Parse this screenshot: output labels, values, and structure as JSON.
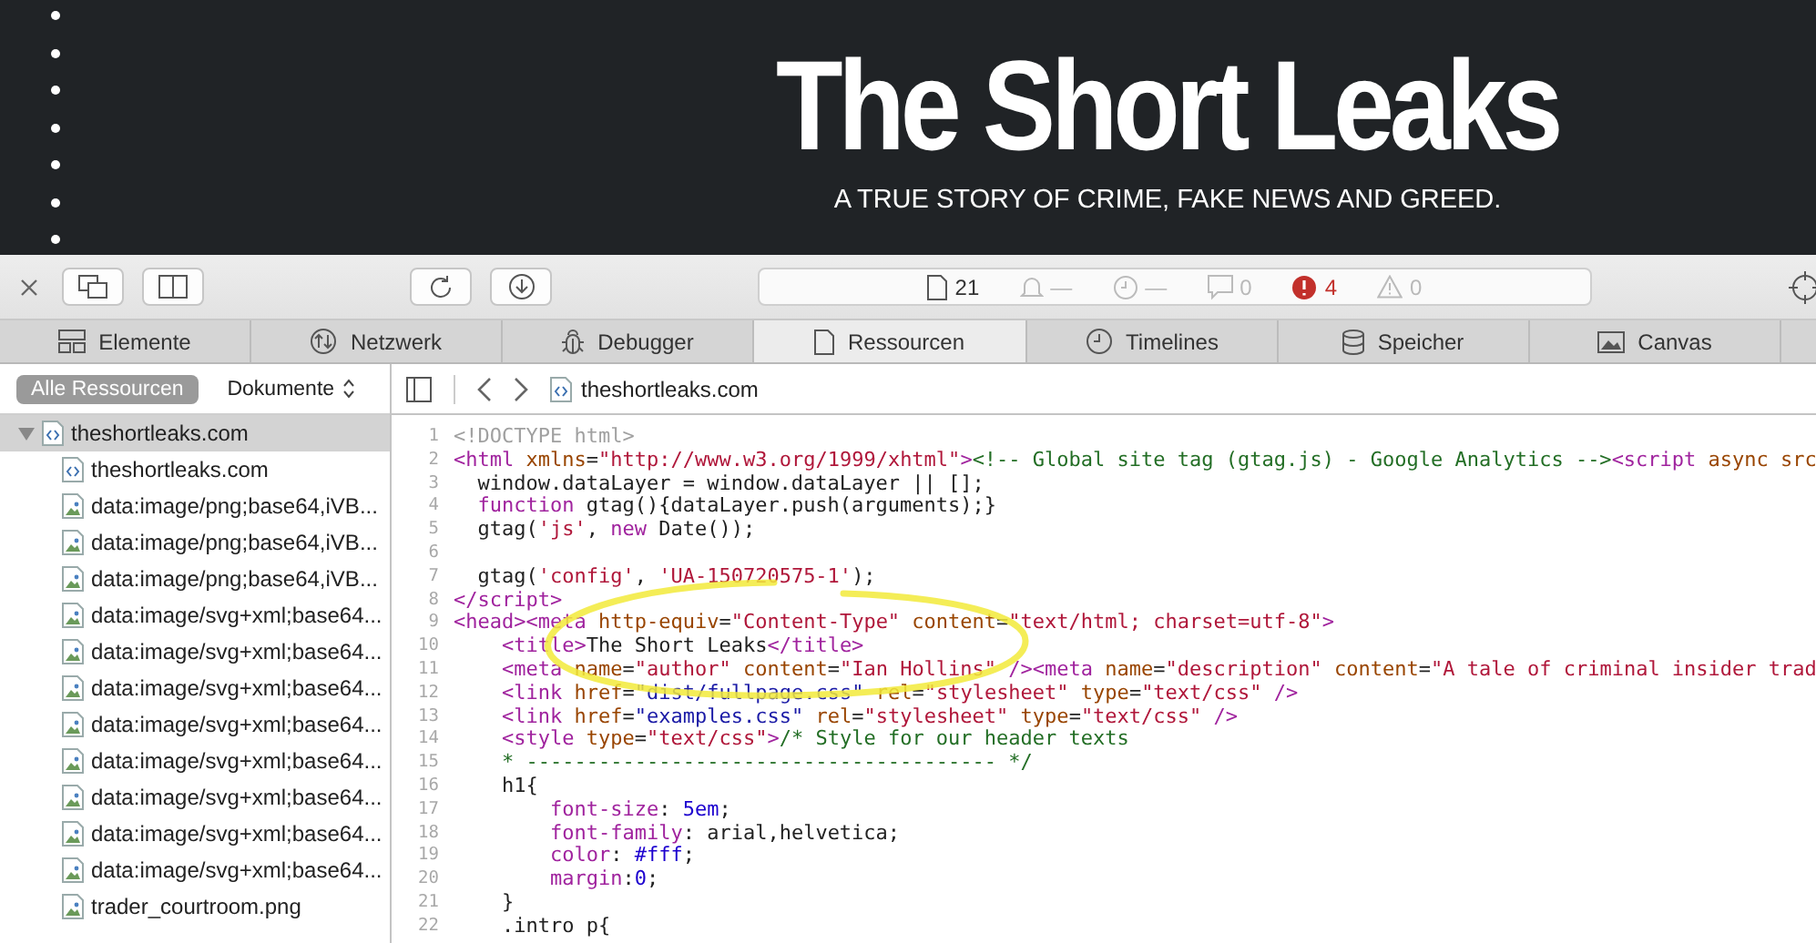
{
  "header": {
    "title": "The Short Leaks",
    "tagline": "A TRUE STORY OF CRIME, FAKE NEWS AND GREED."
  },
  "toolbar": {
    "status": [
      {
        "kind": "document",
        "text": "21"
      },
      {
        "kind": "bell",
        "text": "—"
      },
      {
        "kind": "clock",
        "text": "—"
      },
      {
        "kind": "log",
        "text": "0"
      },
      {
        "kind": "error",
        "text": "4"
      },
      {
        "kind": "warning",
        "text": "0"
      }
    ]
  },
  "tabs": [
    {
      "label": "Elemente",
      "kind": "elements",
      "selected": false
    },
    {
      "label": "Netzwerk",
      "kind": "network",
      "selected": false
    },
    {
      "label": "Debugger",
      "kind": "debugger",
      "selected": false
    },
    {
      "label": "Ressourcen",
      "kind": "resources",
      "selected": true
    },
    {
      "label": "Timelines",
      "kind": "timelines",
      "selected": false
    },
    {
      "label": "Speicher",
      "kind": "storage",
      "selected": false
    },
    {
      "label": "Canvas",
      "kind": "canvas",
      "selected": false
    }
  ],
  "sidebar": {
    "filters": [
      {
        "label": "Alle Ressourcen",
        "kind": "toggle",
        "selected": true
      },
      {
        "label": "Dokumente",
        "kind": "popup",
        "selected": false
      }
    ],
    "tree": [
      {
        "label": "theshortleaks.com",
        "kind": "html",
        "expanded": true,
        "selected": true,
        "children": [
          {
            "label": "theshortleaks.com",
            "kind": "html",
            "selected": false
          },
          {
            "label": "data:image/png;base64,iVB...",
            "kind": "image",
            "selected": false
          },
          {
            "label": "data:image/png;base64,iVB...",
            "kind": "image",
            "selected": false
          },
          {
            "label": "data:image/png;base64,iVB...",
            "kind": "image",
            "selected": false
          },
          {
            "label": "data:image/svg+xml;base64...",
            "kind": "image",
            "selected": false
          },
          {
            "label": "data:image/svg+xml;base64...",
            "kind": "image",
            "selected": false
          },
          {
            "label": "data:image/svg+xml;base64...",
            "kind": "image",
            "selected": false
          },
          {
            "label": "data:image/svg+xml;base64...",
            "kind": "image",
            "selected": false
          },
          {
            "label": "data:image/svg+xml;base64...",
            "kind": "image",
            "selected": false
          },
          {
            "label": "data:image/svg+xml;base64...",
            "kind": "image",
            "selected": false
          },
          {
            "label": "data:image/svg+xml;base64...",
            "kind": "image",
            "selected": false
          },
          {
            "label": "data:image/svg+xml;base64...",
            "kind": "image",
            "selected": false
          },
          {
            "label": "trader_courtroom.png",
            "kind": "image",
            "selected": false
          }
        ]
      }
    ]
  },
  "editor": {
    "file": "theshortleaks.com",
    "lines": [
      {
        "number": "1",
        "tokens": [
          {
            "kind": "doctype",
            "text": "<!DOCTYPE html>"
          }
        ]
      },
      {
        "number": "2",
        "tokens": [
          {
            "kind": "tag",
            "text": "<html "
          },
          {
            "kind": "attr",
            "text": "xmlns"
          },
          {
            "kind": "plain",
            "text": "="
          },
          {
            "kind": "string",
            "text": "\"http://www.w3.org/1999/xhtml\""
          },
          {
            "kind": "tag",
            "text": ">"
          },
          {
            "kind": "comment",
            "text": "<!-- Global site tag (gtag.js) - Google Analytics -->"
          },
          {
            "kind": "tag",
            "text": "<script "
          },
          {
            "kind": "attr",
            "text": "async src"
          }
        ]
      },
      {
        "number": "3",
        "tokens": [
          {
            "kind": "plain",
            "text": "  window.dataLayer = window.dataLayer || [];"
          }
        ]
      },
      {
        "number": "4",
        "tokens": [
          {
            "kind": "keyword",
            "text": "  function"
          },
          {
            "kind": "plain",
            "text": " gtag(){dataLayer.push(arguments);}"
          }
        ]
      },
      {
        "number": "5",
        "tokens": [
          {
            "kind": "plain",
            "text": "  gtag("
          },
          {
            "kind": "string",
            "text": "'js'"
          },
          {
            "kind": "plain",
            "text": ", "
          },
          {
            "kind": "keyword",
            "text": "new"
          },
          {
            "kind": "plain",
            "text": " Date());"
          }
        ]
      },
      {
        "number": "6"
      },
      {
        "number": "7",
        "tokens": [
          {
            "kind": "plain",
            "text": "  gtag("
          },
          {
            "kind": "string",
            "text": "'config'"
          },
          {
            "kind": "plain",
            "text": ", "
          },
          {
            "kind": "string",
            "text": "'UA-150720575-1'"
          },
          {
            "kind": "plain",
            "text": ");"
          }
        ]
      },
      {
        "number": "8",
        "tokens": [
          {
            "kind": "tag",
            "text": "</script>"
          }
        ]
      },
      {
        "number": "9",
        "tokens": [
          {
            "kind": "tag",
            "text": "<head><meta "
          },
          {
            "kind": "attr",
            "text": "http-equiv"
          },
          {
            "kind": "plain",
            "text": "="
          },
          {
            "kind": "string",
            "text": "\"Content-Type\""
          },
          {
            "kind": "attr",
            "text": " content"
          },
          {
            "kind": "plain",
            "text": "="
          },
          {
            "kind": "string",
            "text": "\"text/html; charset=utf-8\""
          },
          {
            "kind": "tag",
            "text": ">"
          }
        ]
      },
      {
        "number": "10",
        "tokens": [
          {
            "kind": "tag",
            "text": "    <title>"
          },
          {
            "kind": "plain",
            "text": "The Short Leaks"
          },
          {
            "kind": "tag",
            "text": "</title>"
          }
        ]
      },
      {
        "number": "11",
        "tokens": [
          {
            "kind": "tag",
            "text": "    <meta "
          },
          {
            "kind": "attr",
            "text": "name"
          },
          {
            "kind": "plain",
            "text": "="
          },
          {
            "kind": "string",
            "text": "\"author\""
          },
          {
            "kind": "attr",
            "text": " content"
          },
          {
            "kind": "plain",
            "text": "="
          },
          {
            "kind": "string",
            "text": "\"Ian Hollins\""
          },
          {
            "kind": "tag",
            "text": " /><meta "
          },
          {
            "kind": "attr",
            "text": "name"
          },
          {
            "kind": "plain",
            "text": "="
          },
          {
            "kind": "string",
            "text": "\"description\""
          },
          {
            "kind": "attr",
            "text": " content"
          },
          {
            "kind": "plain",
            "text": "="
          },
          {
            "kind": "string",
            "text": "\"A tale of criminal insider trad"
          }
        ]
      },
      {
        "number": "12",
        "tokens": [
          {
            "kind": "tag",
            "text": "    <link "
          },
          {
            "kind": "attr",
            "text": "href"
          },
          {
            "kind": "plain",
            "text": "="
          },
          {
            "kind": "url",
            "text": "\"dist/fullpage.css\""
          },
          {
            "kind": "attr",
            "text": " rel"
          },
          {
            "kind": "plain",
            "text": "="
          },
          {
            "kind": "string",
            "text": "\"stylesheet\""
          },
          {
            "kind": "attr",
            "text": " type"
          },
          {
            "kind": "plain",
            "text": "="
          },
          {
            "kind": "string",
            "text": "\"text/css\""
          },
          {
            "kind": "tag",
            "text": " />"
          }
        ]
      },
      {
        "number": "13",
        "tokens": [
          {
            "kind": "tag",
            "text": "    <link "
          },
          {
            "kind": "attr",
            "text": "href"
          },
          {
            "kind": "plain",
            "text": "="
          },
          {
            "kind": "url",
            "text": "\"examples.css\""
          },
          {
            "kind": "attr",
            "text": " rel"
          },
          {
            "kind": "plain",
            "text": "="
          },
          {
            "kind": "string",
            "text": "\"stylesheet\""
          },
          {
            "kind": "attr",
            "text": " type"
          },
          {
            "kind": "plain",
            "text": "="
          },
          {
            "kind": "string",
            "text": "\"text/css\""
          },
          {
            "kind": "tag",
            "text": " />"
          }
        ]
      },
      {
        "number": "14",
        "tokens": [
          {
            "kind": "tag",
            "text": "    <style "
          },
          {
            "kind": "attr",
            "text": "type"
          },
          {
            "kind": "plain",
            "text": "="
          },
          {
            "kind": "string",
            "text": "\"text/css\""
          },
          {
            "kind": "tag",
            "text": ">"
          },
          {
            "kind": "comment",
            "text": "/* Style for our header texts"
          }
        ]
      },
      {
        "number": "15",
        "tokens": [
          {
            "kind": "comment",
            "text": "    * --------------------------------------- */"
          }
        ]
      },
      {
        "number": "16",
        "tokens": [
          {
            "kind": "plain",
            "text": "    h1{"
          }
        ]
      },
      {
        "number": "17",
        "tokens": [
          {
            "kind": "property",
            "text": "        font-size"
          },
          {
            "kind": "plain",
            "text": ": "
          },
          {
            "kind": "number",
            "text": "5em"
          },
          {
            "kind": "plain",
            "text": ";"
          }
        ]
      },
      {
        "number": "18",
        "tokens": [
          {
            "kind": "property",
            "text": "        font-family"
          },
          {
            "kind": "plain",
            "text": ": arial,helvetica;"
          }
        ]
      },
      {
        "number": "19",
        "tokens": [
          {
            "kind": "property",
            "text": "        color"
          },
          {
            "kind": "plain",
            "text": ": "
          },
          {
            "kind": "number",
            "text": "#fff"
          },
          {
            "kind": "plain",
            "text": ";"
          }
        ]
      },
      {
        "number": "20",
        "tokens": [
          {
            "kind": "property",
            "text": "        margin"
          },
          {
            "kind": "plain",
            "text": ":"
          },
          {
            "kind": "number",
            "text": "0"
          },
          {
            "kind": "plain",
            "text": ";"
          }
        ]
      },
      {
        "number": "21",
        "tokens": [
          {
            "kind": "plain",
            "text": "    }"
          }
        ]
      },
      {
        "number": "22",
        "tokens": [
          {
            "kind": "plain",
            "text": "    .intro p{"
          }
        ]
      }
    ]
  }
}
